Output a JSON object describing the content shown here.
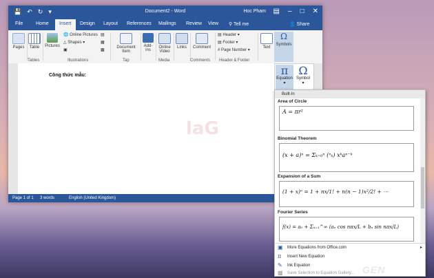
{
  "window": {
    "title": "Document2 - Word",
    "user": "Hoc Pham",
    "qa_icons": [
      "save-icon",
      "undo-icon",
      "redo-icon"
    ],
    "controls": [
      "minimize-icon",
      "maximize-icon",
      "close-icon"
    ]
  },
  "tabs": [
    "File",
    "Home",
    "Insert",
    "Design",
    "Layout",
    "References",
    "Mailings",
    "Review",
    "View"
  ],
  "active_tab": "Insert",
  "tell_me": "Tell me",
  "share": "Share",
  "ribbon": {
    "pages": "Pages",
    "table": "Table",
    "tables_group": "Tables",
    "pictures": "Pictures",
    "online_pictures": "Online Pictures",
    "shapes": "Shapes",
    "illustrations_group": "Illustrations",
    "document_item": "Document Item",
    "tap_group": "Tap",
    "addins": "Add-ins",
    "online_video": "Online Video",
    "media_group": "Media",
    "links": "Links",
    "comment": "Comment",
    "comments_group": "Comments",
    "header": "Header",
    "footer": "Footer",
    "page_number": "Page Number",
    "header_footer_group": "Header & Footer",
    "text": "Text",
    "symbols": "Symbols"
  },
  "document": {
    "text": "Công thức mẫu:"
  },
  "status": {
    "page": "Page 1 of 1",
    "words": "3 words",
    "language": "English (United Kingdom)"
  },
  "symbols_panel": {
    "equation": "Equation",
    "symbol": "Symbol"
  },
  "gallery": {
    "header": "Built-In",
    "items": [
      {
        "title": "Area of Circle",
        "formula": "A = πr²"
      },
      {
        "title": "Binomial Theorem",
        "formula": "(x + a)ⁿ = Σₖ₌₀ⁿ (ⁿₖ) xᵏaⁿ⁻ᵏ"
      },
      {
        "title": "Expansion of a Sum",
        "formula": "(1 + x)ⁿ = 1 + nx/1! + n(n − 1)x²/2! + ⋯"
      },
      {
        "title": "Fourier Series",
        "formula": "f(x) = a₀ + Σₙ₌₁^∞ (aₙ cos nπx/L + bₙ sin nπx/L)"
      }
    ],
    "menu": [
      {
        "icon": "office-equation-icon",
        "label": "More Equations from Office.com"
      },
      {
        "icon": "pi-icon",
        "label": "Insert New Equation"
      },
      {
        "icon": "ink-equation-icon",
        "label": "Ink Equation"
      },
      {
        "icon": "save-gallery-icon",
        "label": "Save Selection to Equation Gallery..."
      }
    ]
  },
  "watermark": "GEN"
}
